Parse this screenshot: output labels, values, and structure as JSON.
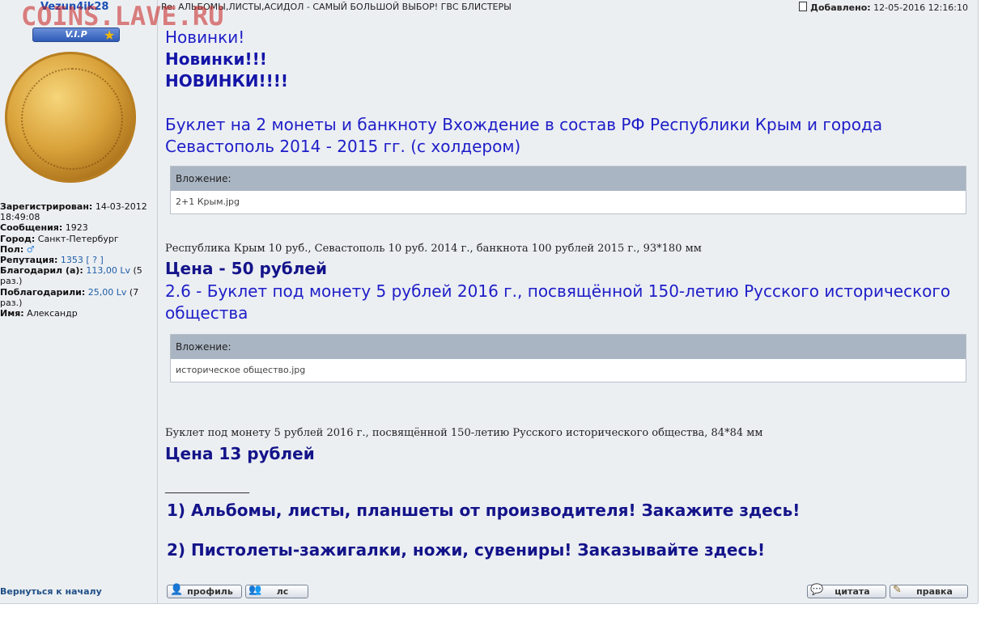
{
  "watermark": "COINS.LAVE.RU",
  "author": {
    "username": "Vezun4ik28",
    "badge": "V.I.P",
    "registered_label": "Зарегистрирован:",
    "registered_value": "14-03-2012 18:49:08",
    "messages_label": "Сообщения:",
    "messages_value": "1923",
    "city_label": "Город:",
    "city_value": "Санкт-Петербург",
    "gender_label": "Пол:",
    "gender_icon": "male-icon",
    "reputation_label": "Репутация:",
    "reputation_value": "1353",
    "reputation_help": "[ ? ]",
    "thanked_label": "Благодарил (а):",
    "thanked_value": "113,00 Lv",
    "thanked_count": "(5 раз.)",
    "thanked_by_label": "Поблагодарили:",
    "thanked_by_value": "25,00 Lv",
    "thanked_by_count": "(7 раз.)",
    "name_label": "Имя:",
    "name_value": "Александр"
  },
  "header": {
    "subject": "Re: АЛЬБОМЫ,ЛИСТЫ,АСИДОЛ - САМЫЙ БОЛЬШОЙ ВЫБОР! ГВС БЛИСТЕРЫ",
    "posted_label": "Добавлено:",
    "posted_value": "12-05-2016 12:16:10"
  },
  "content": {
    "line1": "Новинки!",
    "line2": "Новинки!!!",
    "line3": "НОВИНКИ!!!!",
    "item1_title": "Буклет на 2 монеты и банкноту Вхождение в состав РФ Республики Крым и города Севастополь 2014 - 2015 гг. (с холдером)",
    "attach_label": "Вложение:",
    "attach1_file": "2+1 Крым.jpg",
    "item1_desc": "Республика Крым 10 руб., Севастополь 10 руб. 2014 г., банкнота 100 рублей 2015 г., 93*180 мм",
    "item1_price": "Цена - 50 рублей",
    "item2_title": "2.6 - Буклет под монету 5 рублей 2016 г., посвящённой 150-летию Русского исторического общества",
    "attach2_file": "историческое общество.jpg",
    "item2_desc": "Буклет под монету 5 рублей 2016 г., посвящённой 150-летию Русского исторического общества, 84*84 мм",
    "item2_price": "Цена 13 рублей",
    "signature_rule": "________________",
    "sig1": "1) Альбомы, листы, планшеты от производителя! Закажите здесь!",
    "sig2": "2) Пистолеты-зажигалки, ножи, сувениры! Заказывайте здесь!"
  },
  "footer": {
    "back_link": "Вернуться к началу",
    "profile_btn": "профиль",
    "pm_btn": "лс",
    "quote_btn": "цитата",
    "edit_btn": "правка"
  }
}
